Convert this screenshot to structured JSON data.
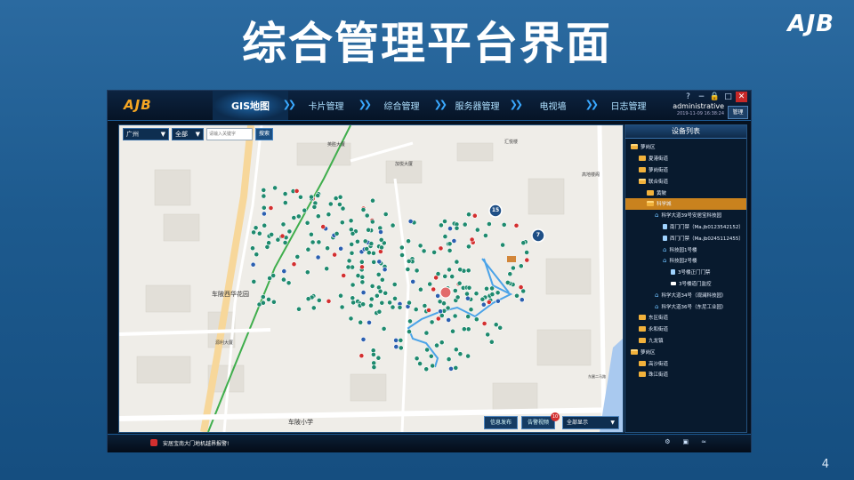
{
  "slide": {
    "title": "综合管理平台界面",
    "logo": "AJB",
    "page_number": "4"
  },
  "app": {
    "logo": "AJB",
    "nav_tabs": [
      {
        "label": "GIS地图",
        "active": true
      },
      {
        "label": "卡片管理",
        "active": false
      },
      {
        "label": "综合管理",
        "active": false
      },
      {
        "label": "服务器管理",
        "active": false
      },
      {
        "label": "电视墙",
        "active": false
      },
      {
        "label": "日志管理",
        "active": false
      }
    ],
    "window_controls": {
      "help": "?",
      "minimize": "−",
      "lock": "🔒",
      "maximize": "□",
      "close": "✕"
    },
    "user": {
      "name": "administrative",
      "datetime": "2019-11-09  16:38:24"
    },
    "manage_label": "管理"
  },
  "map": {
    "toolbar": {
      "city": "广州",
      "district": "全部",
      "search_placeholder": "请输入关键字",
      "search_button": "搜索"
    },
    "labels": [
      {
        "text": "车陂西华花园"
      },
      {
        "text": "车陂小学"
      },
      {
        "text": "源利大厦"
      },
      {
        "text": "汇悦楼"
      },
      {
        "text": "加悦大厦"
      },
      {
        "text": "英胜大厦"
      },
      {
        "text": "高地楼阁"
      },
      {
        "text": "东圃二马路"
      }
    ],
    "clusters": [
      {
        "count": "15"
      },
      {
        "count": "7"
      }
    ],
    "bottom": {
      "info_button": "信息发布",
      "alarm_button": "告警视频",
      "alarm_badge": "10",
      "display_select": "全部显示"
    }
  },
  "device_list": {
    "title": "设备列表",
    "items": [
      {
        "label": "萝岗区",
        "level": 0,
        "icon": "folder-open"
      },
      {
        "label": "夏港街道",
        "level": 1,
        "icon": "folder"
      },
      {
        "label": "萝岗街道",
        "level": 1,
        "icon": "folder"
      },
      {
        "label": "联合街道",
        "level": 1,
        "icon": "folder-open"
      },
      {
        "label": "黄陂",
        "level": 2,
        "icon": "folder"
      },
      {
        "label": "科学城",
        "level": 2,
        "icon": "folder-open",
        "selected": true
      },
      {
        "label": "科学大道39号安居宝科技园",
        "level": 3,
        "icon": "home"
      },
      {
        "label": "南门门禁（Ma.jb0123542152）",
        "level": 4,
        "icon": "door"
      },
      {
        "label": "西门门禁（Ma.jb0245112455）",
        "level": 4,
        "icon": "door"
      },
      {
        "label": "科技园1号楼",
        "level": 4,
        "icon": "home"
      },
      {
        "label": "科技园2号楼",
        "level": 4,
        "icon": "home"
      },
      {
        "label": "3号楼正门门禁",
        "level": 5,
        "icon": "door"
      },
      {
        "label": "3号楼道门监控",
        "level": 5,
        "icon": "cam"
      },
      {
        "label": "科学大道34号（观澜科技园）",
        "level": 3,
        "icon": "home"
      },
      {
        "label": "科学大道36号（东尼工业园）",
        "level": 3,
        "icon": "home"
      },
      {
        "label": "东区街道",
        "level": 1,
        "icon": "folder"
      },
      {
        "label": "永和街道",
        "level": 1,
        "icon": "folder"
      },
      {
        "label": "九龙镇",
        "level": 1,
        "icon": "folder"
      },
      {
        "label": "萝岗区",
        "level": 0,
        "icon": "folder-open"
      },
      {
        "label": "高沙街道",
        "level": 1,
        "icon": "folder"
      },
      {
        "label": "珠江街道",
        "level": 1,
        "icon": "folder"
      }
    ]
  },
  "statusbar": {
    "alarm_message": "安居宝南大门地机越界报警!",
    "icons": [
      "settings-icon",
      "lock-icon",
      "collapse-icon"
    ]
  },
  "colors": {
    "slide_bg": "#1d5a8e",
    "nav_text": "#aee0ff",
    "active_tab": "#1e66a8",
    "selected_tree": "#c9821e",
    "camera_marker": "#1e8a6e",
    "alarm_red": "#d32f2f",
    "route_line": "#4aa3e8"
  }
}
